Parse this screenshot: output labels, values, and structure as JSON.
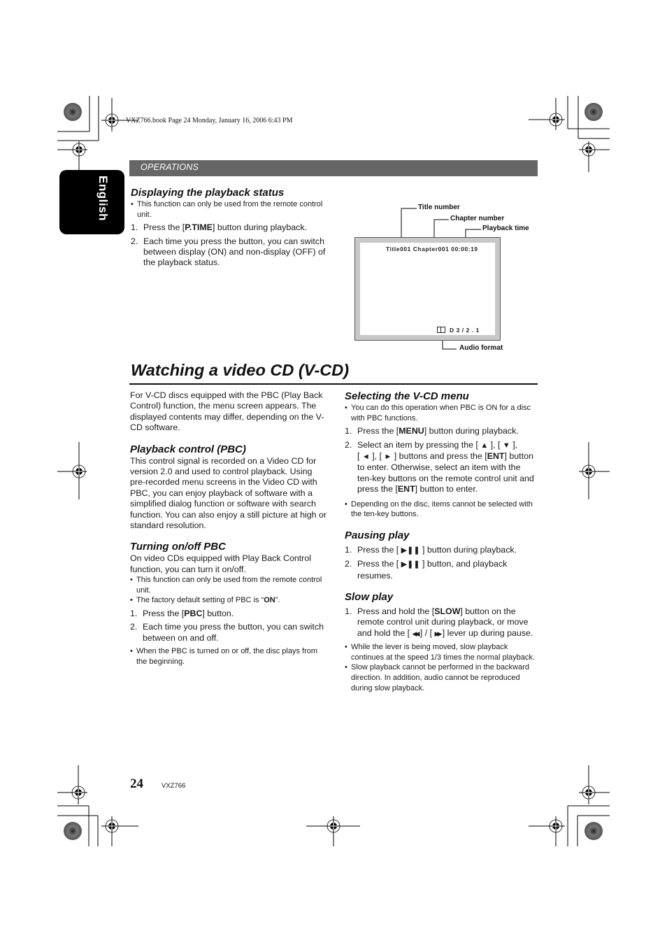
{
  "header": {
    "file_meta": "VXZ766.book  Page 24  Monday, January 16, 2006  6:43 PM",
    "section": "OPERATIONS",
    "language_tab": "English"
  },
  "playback_status": {
    "heading": "Displaying the playback status",
    "bullet": "This function can only be used from the remote control unit.",
    "steps": [
      {
        "n": "1.",
        "pre": "Press the [",
        "bold": "P.TIME",
        "post": "] button during playback."
      },
      {
        "n": "2.",
        "text": "Each time you press the button, you can switch between display (ON) and non-display (OFF) of the playback status."
      }
    ]
  },
  "diagram": {
    "callouts": {
      "title_number": "Title number",
      "chapter_number": "Chapter number",
      "playback_time": "Playback time",
      "audio_format": "Audio format"
    },
    "osd_top": "Title001  Chapter001  00:00:19",
    "osd_bottom_icon": "dolby-icon",
    "osd_bottom": "D  3 / 2 . 1"
  },
  "main": {
    "title": "Watching a video CD (V-CD)",
    "intro": "For V-CD discs equipped with the PBC (Play Back Control) function, the menu screen appears. The displayed contents may differ, depending on the V-CD software.",
    "pbc": {
      "heading": "Playback control (PBC)",
      "body": "This control signal is recorded on a Video CD for version 2.0 and used to control playback. Using pre-recorded menu screens in the Video CD with PBC, you can enjoy playback of software with a simplified dialog function or software with search function. You can also enjoy a still picture at high or standard resolution."
    },
    "turning": {
      "heading": "Turning on/off PBC",
      "body": "On video CDs equipped with Play Back Control function, you can turn it on/off.",
      "bullets": [
        {
          "text": "This function can only be used from the remote control unit."
        },
        {
          "pre": "The factory default setting of PBC is “",
          "bold": "ON",
          "post": "”."
        }
      ],
      "steps": [
        {
          "n": "1.",
          "pre": "Press the [",
          "bold": "PBC",
          "post": "] button."
        },
        {
          "n": "2.",
          "text": "Each time you press the button, you can switch between on and off."
        }
      ],
      "note": "When the PBC is turned on or off, the disc plays from the beginning."
    },
    "selecting": {
      "heading": "Selecting the V-CD menu",
      "bullet": "You can do this operation when PBC is ON for a disc with PBC functions.",
      "step1": {
        "n": "1.",
        "pre": "Press the [",
        "bold": "MENU",
        "post": "] button during playback."
      },
      "step2": {
        "n": "2.",
        "a": "Select an item by pressing the [ ",
        "up": "▲",
        "b": " ], [ ",
        "down": "▼",
        "c": " ],",
        "d": "[ ",
        "left": "◄",
        "e": " ], [ ",
        "right": "►",
        "f": " ] buttons and press the [",
        "ent1": "ENT",
        "g": "] button to enter. Otherwise, select an item with the ten-key buttons on the remote control unit and press the [",
        "ent2": "ENT",
        "h": "] button to enter."
      },
      "note": "Depending on the disc, items cannot be selected with the ten-key buttons."
    },
    "pausing": {
      "heading": "Pausing play",
      "play_pause_glyph": "▶❚❚",
      "step1_pre": "Press the [ ",
      "step1_post": " ] button during playback.",
      "step2_pre": "Press the [ ",
      "step2_post": " ] button, and playback resumes."
    },
    "slow": {
      "heading": "Slow play",
      "step1": {
        "n": "1.",
        "a": "Press and hold the [",
        "bold": "SLOW",
        "b": "] button on the remote control unit during playback, or move and hold the [ ",
        "rew": "◀◀",
        "c": " ] / [ ",
        "ff": "▶▶",
        "d": " ] lever up during pause."
      },
      "bullets": [
        "While the lever is being moved, slow playback continues at the speed 1/3 times the normal playback.",
        "Slow playback cannot be performed in the backward direction. In addition, audio cannot be reproduced during slow playback."
      ]
    }
  },
  "footer": {
    "page_number": "24",
    "model": "VXZ766"
  }
}
